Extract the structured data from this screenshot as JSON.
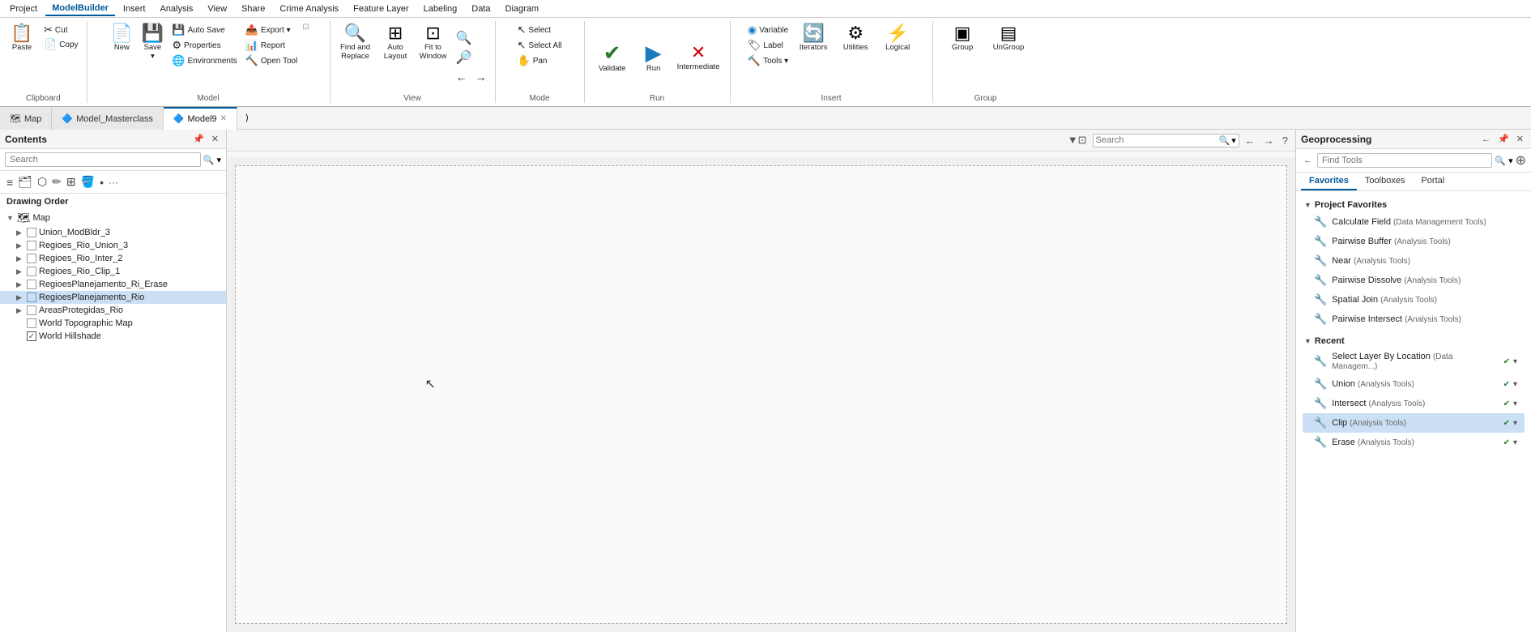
{
  "menubar": {
    "items": [
      "Project",
      "ModelBuilder",
      "Insert",
      "Analysis",
      "View",
      "Share",
      "Crime Analysis",
      "Feature Layer",
      "Labeling",
      "Data",
      "Diagram"
    ],
    "active": "ModelBuilder"
  },
  "ribbon": {
    "groups": [
      {
        "label": "Clipboard",
        "buttons": [
          {
            "id": "paste",
            "label": "Paste",
            "icon": "📋"
          },
          {
            "id": "cut",
            "label": "Cut",
            "icon": "✂️"
          },
          {
            "id": "copy",
            "label": "Copy",
            "icon": "📄"
          }
        ]
      },
      {
        "label": "Model",
        "buttons": [
          {
            "id": "new",
            "label": "New",
            "icon": "📄"
          },
          {
            "id": "save",
            "label": "Save",
            "icon": "💾"
          },
          {
            "id": "autosave",
            "label": "Auto Save",
            "icon": "💾"
          },
          {
            "id": "properties",
            "label": "Properties",
            "icon": "🔧"
          },
          {
            "id": "environments",
            "label": "Environments",
            "icon": "🌐"
          },
          {
            "id": "export",
            "label": "Export",
            "icon": "📤"
          },
          {
            "id": "report",
            "label": "Report",
            "icon": "📊"
          },
          {
            "id": "opentool",
            "label": "Open Tool",
            "icon": "🔨"
          }
        ]
      },
      {
        "label": "View",
        "buttons": [
          {
            "id": "findreplace",
            "label": "Find and\nReplace",
            "icon": "🔍"
          },
          {
            "id": "autolayout",
            "label": "Auto\nLayout",
            "icon": "⊞"
          },
          {
            "id": "fitwindow",
            "label": "Fit to\nWindow",
            "icon": "⊡"
          },
          {
            "id": "zoomin",
            "label": "",
            "icon": "🔍"
          },
          {
            "id": "zoomout",
            "label": "",
            "icon": "🔎"
          },
          {
            "id": "back",
            "label": "",
            "icon": "←"
          },
          {
            "id": "forward",
            "label": "",
            "icon": "→"
          }
        ]
      },
      {
        "label": "Mode",
        "buttons": [
          {
            "id": "select",
            "label": "Select",
            "icon": "↖"
          },
          {
            "id": "selectall",
            "label": "Select All",
            "icon": "↖"
          },
          {
            "id": "pan",
            "label": "Pan",
            "icon": "✋"
          }
        ]
      },
      {
        "label": "Run",
        "buttons": [
          {
            "id": "validate",
            "label": "Validate",
            "icon": "✔"
          },
          {
            "id": "run",
            "label": "Run",
            "icon": "▶"
          },
          {
            "id": "intermediate",
            "label": "Intermediate",
            "icon": "✖"
          }
        ]
      },
      {
        "label": "Insert",
        "buttons": [
          {
            "id": "variable",
            "label": "Variable",
            "icon": "◉"
          },
          {
            "id": "label",
            "label": "Label",
            "icon": "🏷"
          },
          {
            "id": "tools",
            "label": "Tools ▾",
            "icon": "🔨"
          },
          {
            "id": "iterators",
            "label": "Iterators",
            "icon": "🔄"
          },
          {
            "id": "utilities",
            "label": "Utilities",
            "icon": "⚙"
          },
          {
            "id": "logical",
            "label": "Logical",
            "icon": "⚡"
          }
        ]
      },
      {
        "label": "Group",
        "buttons": [
          {
            "id": "group",
            "label": "Group",
            "icon": "▣"
          },
          {
            "id": "ungroup",
            "label": "UnGroup",
            "icon": "▤"
          }
        ]
      }
    ]
  },
  "tabs": {
    "items": [
      {
        "id": "map",
        "label": "Map",
        "icon": "🗺",
        "closeable": false,
        "active": false
      },
      {
        "id": "model_masterclass",
        "label": "Model_Masterclass",
        "icon": "🔷",
        "closeable": false,
        "active": false
      },
      {
        "id": "model9",
        "label": "Model9",
        "icon": "🔷",
        "closeable": true,
        "active": true
      }
    ]
  },
  "contents": {
    "title": "Contents",
    "search_placeholder": "Search",
    "drawing_order_label": "Drawing Order",
    "layers": [
      {
        "id": "map_root",
        "label": "Map",
        "icon": "🗺",
        "indent": 0,
        "arrow": true,
        "expanded": true,
        "checkbox": false
      },
      {
        "id": "union_modbldr3",
        "label": "Union_ModBldr_3",
        "indent": 1,
        "arrow": true,
        "checkbox": true,
        "checked": false
      },
      {
        "id": "regioes_rio_union3",
        "label": "Regioes_Rio_Union_3",
        "indent": 1,
        "arrow": true,
        "checkbox": true,
        "checked": false
      },
      {
        "id": "regioes_rio_inter2",
        "label": "Regioes_Rio_Inter_2",
        "indent": 1,
        "arrow": true,
        "checkbox": true,
        "checked": false
      },
      {
        "id": "regioes_rio_clip1",
        "label": "Regioes_Rio_Clip_1",
        "indent": 1,
        "arrow": true,
        "checkbox": true,
        "checked": false
      },
      {
        "id": "regioes_planejamento_ri_erase",
        "label": "RegioesPlanejamento_Ri_Erase",
        "indent": 1,
        "arrow": true,
        "checkbox": true,
        "checked": false
      },
      {
        "id": "regioes_planejamento_rio",
        "label": "RegioesPlanejamento_Rio",
        "indent": 1,
        "arrow": true,
        "checkbox": true,
        "checked": false,
        "selected": true
      },
      {
        "id": "areas_protegidas_rio",
        "label": "AreasProtegidas_Rio",
        "indent": 1,
        "arrow": true,
        "checkbox": true,
        "checked": false
      },
      {
        "id": "world_topographic_map",
        "label": "World Topographic Map",
        "indent": 1,
        "arrow": false,
        "checkbox": true,
        "checked": false
      },
      {
        "id": "world_hillshade",
        "label": "World Hillshade",
        "indent": 1,
        "arrow": false,
        "checkbox": true,
        "checked": true
      }
    ]
  },
  "geoprocessing": {
    "title": "Geoprocessing",
    "find_tools_placeholder": "Find Tools",
    "tabs": [
      "Favorites",
      "Toolboxes",
      "Portal"
    ],
    "active_tab": "Favorites",
    "sections": [
      {
        "id": "project_favorites",
        "label": "Project Favorites",
        "expanded": true,
        "items": [
          {
            "name": "Calculate Field",
            "category": "(Data Management Tools)"
          },
          {
            "name": "Pairwise Buffer",
            "category": "(Analysis Tools)"
          },
          {
            "name": "Near",
            "category": "(Analysis Tools)"
          },
          {
            "name": "Pairwise Dissolve",
            "category": "(Analysis Tools)"
          },
          {
            "name": "Spatial Join",
            "category": "(Analysis Tools)"
          },
          {
            "name": "Pairwise Intersect",
            "category": "(Analysis Tools)"
          }
        ]
      },
      {
        "id": "recent",
        "label": "Recent",
        "expanded": true,
        "items": [
          {
            "name": "Select Layer By Location",
            "category": "(Data Managem...)",
            "selected": false
          },
          {
            "name": "Union",
            "category": "(Analysis Tools)",
            "selected": false
          },
          {
            "name": "Intersect",
            "category": "(Analysis Tools)",
            "selected": false
          },
          {
            "name": "Clip",
            "category": "(Analysis Tools)",
            "selected": true
          },
          {
            "name": "Erase",
            "category": "(Analysis Tools)",
            "selected": false
          }
        ]
      }
    ]
  }
}
